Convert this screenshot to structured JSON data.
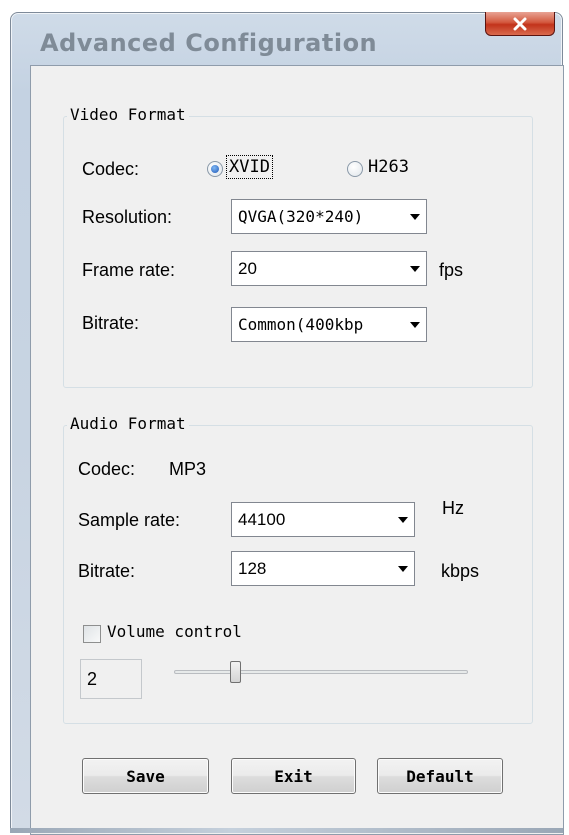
{
  "window": {
    "title": "Advanced Configuration",
    "close_symbol": "x"
  },
  "video": {
    "legend": "Video Format",
    "codec_label": "Codec:",
    "codec_options": [
      {
        "label": "XVID",
        "checked": true
      },
      {
        "label": "H263",
        "checked": false
      }
    ],
    "resolution_label": "Resolution:",
    "resolution_value": "QVGA(320*240)",
    "frame_rate_label": "Frame rate:",
    "frame_rate_value": "20",
    "frame_rate_unit": "fps",
    "bitrate_label": "Bitrate:",
    "bitrate_value": "Common(400kbp"
  },
  "audio": {
    "legend": "Audio Format",
    "codec_label": "Codec:",
    "codec_value": "MP3",
    "sample_rate_label": "Sample rate:",
    "sample_rate_value": "44100",
    "sample_rate_unit": "Hz",
    "bitrate_label": "Bitrate:",
    "bitrate_value": "128",
    "bitrate_unit": "kbps",
    "volume_control_label": "Volume control",
    "volume_control_checked": false,
    "volume_value": "2"
  },
  "buttons": {
    "save": "Save",
    "exit": "Exit",
    "default": "Default"
  }
}
